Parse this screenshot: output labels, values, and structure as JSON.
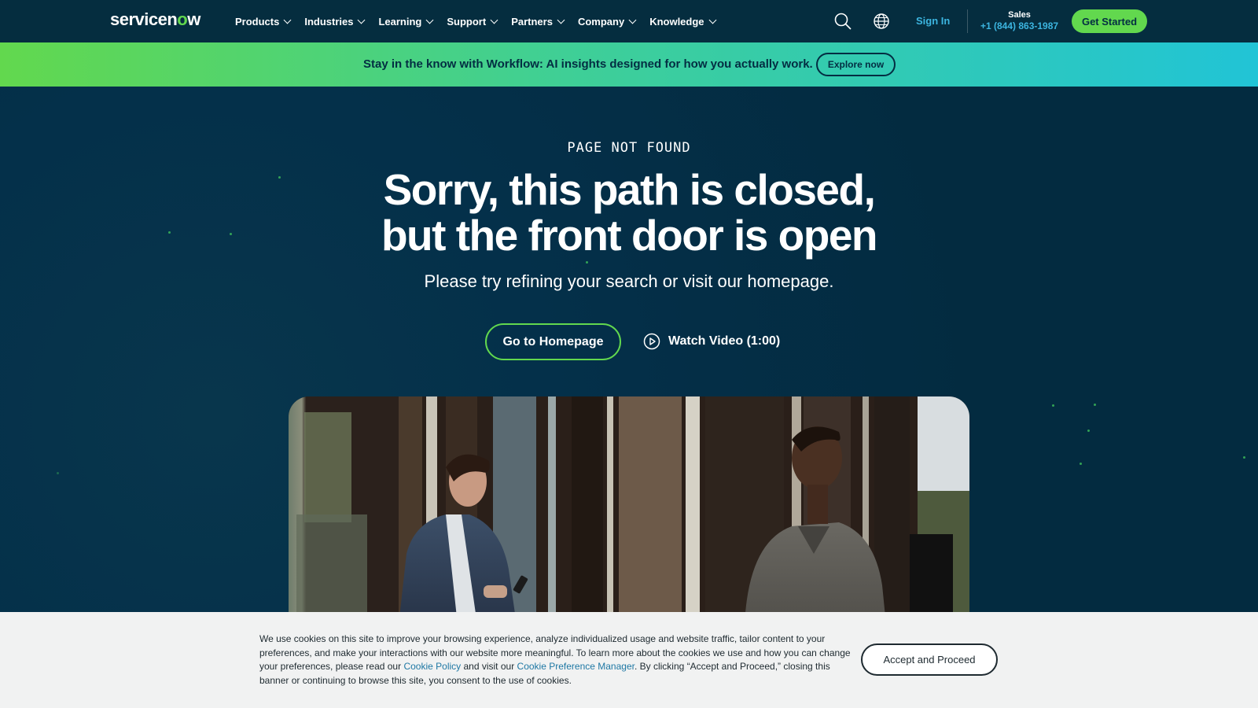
{
  "header": {
    "logo": {
      "before": "servicen",
      "o": "o",
      "after": "w"
    },
    "nav": [
      {
        "label": "Products"
      },
      {
        "label": "Industries"
      },
      {
        "label": "Learning"
      },
      {
        "label": "Support"
      },
      {
        "label": "Partners"
      },
      {
        "label": "Company"
      },
      {
        "label": "Knowledge"
      }
    ],
    "sign_in": "Sign In",
    "sales_label": "Sales",
    "sales_phone": "+1 (844) 863-1987",
    "cta": "Get Started"
  },
  "promo": {
    "text": "Stay in the know with Workflow: AI insights designed for how you actually work.",
    "button": "Explore now"
  },
  "hero": {
    "eyebrow": "PAGE NOT FOUND",
    "title_line1": "Sorry, this path is closed,",
    "title_line2": "but the front door is open",
    "subtitle": "Please try refining your search or visit our homepage.",
    "primary_button": "Go to Homepage",
    "video_link": "Watch Video (1:00)"
  },
  "cookie": {
    "text_1": "We use cookies on this site to improve your browsing experience, analyze individualized usage and website traffic, tailor content to your preferences, and make your interactions with our website more meaningful. To learn more about the cookies we use and how you can change your preferences, please read our ",
    "link_policy": "Cookie Policy",
    "text_2": " and visit our ",
    "link_manager": "Cookie Preference Manager",
    "text_3": ". By clicking “Accept and Proceed,” closing this banner or continuing to browse this site, you consent to the use of cookies.",
    "accept": "Accept and Proceed"
  },
  "colors": {
    "brand_green": "#62d84e",
    "navy": "#032d42",
    "link_blue": "#3cb5e0"
  },
  "icons": [
    "search-icon",
    "globe-icon",
    "chevron-down-icon",
    "play-icon"
  ]
}
